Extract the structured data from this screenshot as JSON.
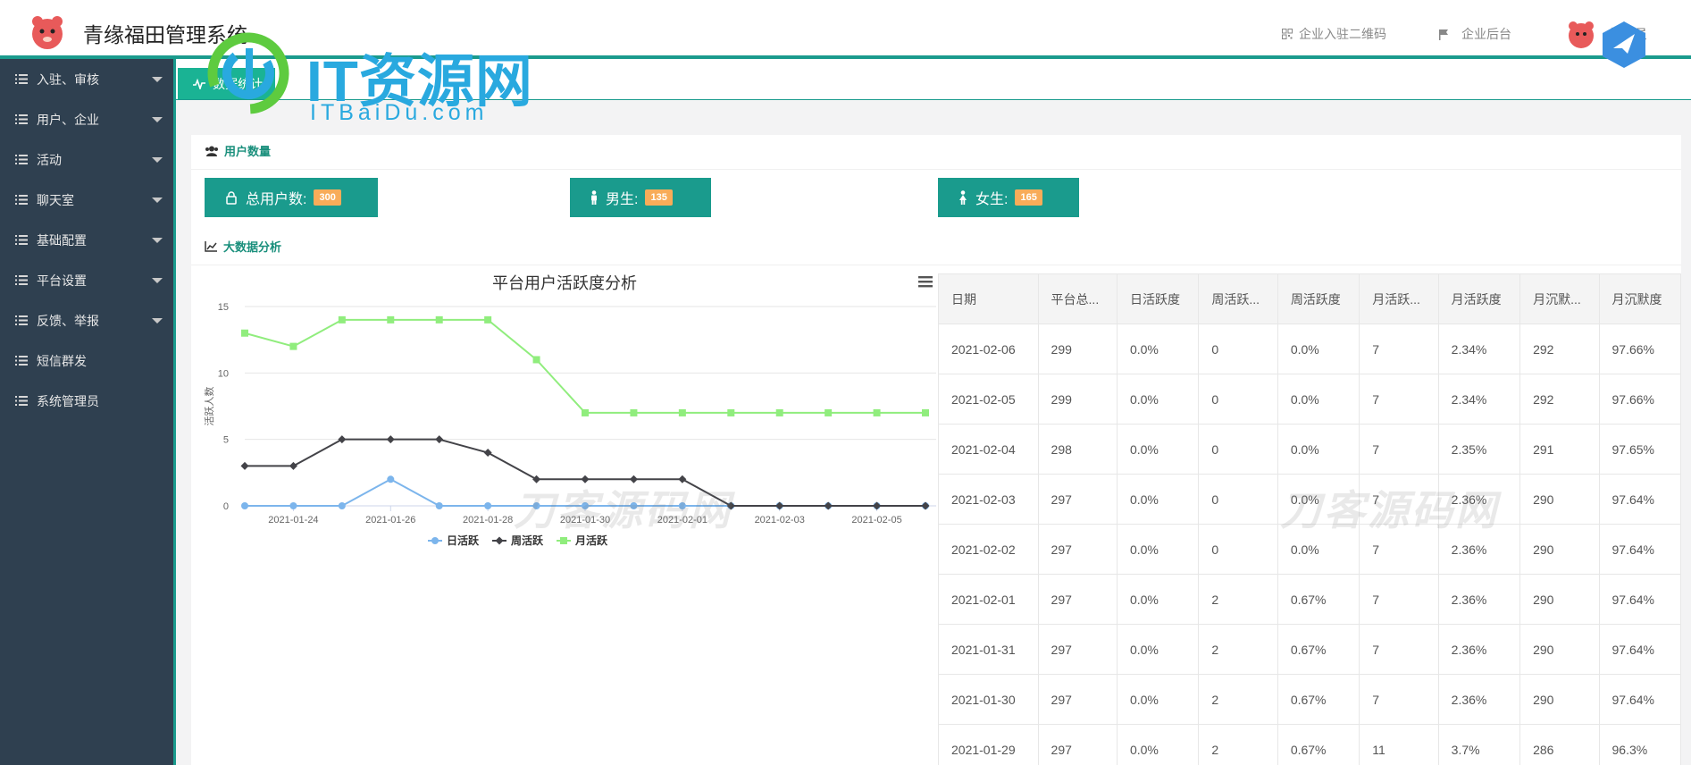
{
  "header": {
    "app_title": "青缘福田管理系统",
    "qr_link": "企业入驻二维码",
    "backend_link": "企业后台",
    "admin_label": "管理员"
  },
  "watermark": {
    "brand": "IT资源网",
    "url": "ITBaiDu.com",
    "ghost_text": "刀客源码网"
  },
  "sidebar": {
    "items": [
      {
        "label": "入驻、审核",
        "has_caret": true
      },
      {
        "label": "用户、企业",
        "has_caret": true
      },
      {
        "label": "活动",
        "has_caret": true
      },
      {
        "label": "聊天室",
        "has_caret": true
      },
      {
        "label": "基础配置",
        "has_caret": true
      },
      {
        "label": "平台设置",
        "has_caret": true
      },
      {
        "label": "反馈、举报",
        "has_caret": true
      },
      {
        "label": "短信群发",
        "has_caret": false
      },
      {
        "label": "系统管理员",
        "has_caret": false
      }
    ]
  },
  "tabs": {
    "active": "数据统计"
  },
  "user_section": {
    "title": "用户数量",
    "stats": [
      {
        "label": "总用户数:",
        "value": "300",
        "icon": "user-icon"
      },
      {
        "label": "男生:",
        "value": "135",
        "icon": "male-icon"
      },
      {
        "label": "女生:",
        "value": "165",
        "icon": "female-icon"
      }
    ]
  },
  "analysis_section": {
    "title": "大数据分析"
  },
  "chart_data": {
    "type": "line",
    "title": "平台用户活跃度分析",
    "ylabel": "活跃人数",
    "xlabel": "",
    "ylim": [
      0,
      15
    ],
    "yticks": [
      0,
      5,
      10,
      15
    ],
    "x": [
      "2021-01-23",
      "2021-01-24",
      "2021-01-25",
      "2021-01-26",
      "2021-01-27",
      "2021-01-28",
      "2021-01-29",
      "2021-01-30",
      "2021-01-31",
      "2021-02-01",
      "2021-02-02",
      "2021-02-03",
      "2021-02-04",
      "2021-02-05",
      "2021-02-06"
    ],
    "xtick_labels": [
      "2021-01-24",
      "2021-01-26",
      "2021-01-28",
      "2021-01-30",
      "2021-02-01",
      "2021-02-03",
      "2021-02-05"
    ],
    "legend_position": "bottom",
    "series": [
      {
        "name": "日活跃",
        "color": "#7cb5ec",
        "marker": "circle",
        "values": [
          0,
          0,
          0,
          2,
          0,
          0,
          0,
          0,
          0,
          0,
          0,
          0,
          0,
          0,
          0
        ]
      },
      {
        "name": "周活跃",
        "color": "#434348",
        "marker": "diamond",
        "values": [
          3,
          3,
          5,
          5,
          5,
          4,
          2,
          2,
          2,
          2,
          0,
          0,
          0,
          0,
          0
        ]
      },
      {
        "name": "月活跃",
        "color": "#90ed7d",
        "marker": "square",
        "values": [
          13,
          12,
          14,
          14,
          14,
          14,
          11,
          7,
          7,
          7,
          7,
          7,
          7,
          7,
          7
        ]
      }
    ]
  },
  "table": {
    "headers": [
      "日期",
      "平台总...",
      "日活跃度",
      "周活跃...",
      "周活跃度",
      "月活跃...",
      "月活跃度",
      "月沉默...",
      "月沉默度"
    ],
    "rows": [
      [
        "2021-02-06",
        "299",
        "0.0%",
        "0",
        "0.0%",
        "7",
        "2.34%",
        "292",
        "97.66%"
      ],
      [
        "2021-02-05",
        "299",
        "0.0%",
        "0",
        "0.0%",
        "7",
        "2.34%",
        "292",
        "97.66%"
      ],
      [
        "2021-02-04",
        "298",
        "0.0%",
        "0",
        "0.0%",
        "7",
        "2.35%",
        "291",
        "97.65%"
      ],
      [
        "2021-02-03",
        "297",
        "0.0%",
        "0",
        "0.0%",
        "7",
        "2.36%",
        "290",
        "97.64%"
      ],
      [
        "2021-02-02",
        "297",
        "0.0%",
        "0",
        "0.0%",
        "7",
        "2.36%",
        "290",
        "97.64%"
      ],
      [
        "2021-02-01",
        "297",
        "0.0%",
        "2",
        "0.67%",
        "7",
        "2.36%",
        "290",
        "97.64%"
      ],
      [
        "2021-01-31",
        "297",
        "0.0%",
        "2",
        "0.67%",
        "7",
        "2.36%",
        "290",
        "97.64%"
      ],
      [
        "2021-01-30",
        "297",
        "0.0%",
        "2",
        "0.67%",
        "7",
        "2.36%",
        "290",
        "97.64%"
      ],
      [
        "2021-01-29",
        "297",
        "0.0%",
        "2",
        "0.67%",
        "11",
        "3.7%",
        "286",
        "96.3%"
      ]
    ]
  }
}
